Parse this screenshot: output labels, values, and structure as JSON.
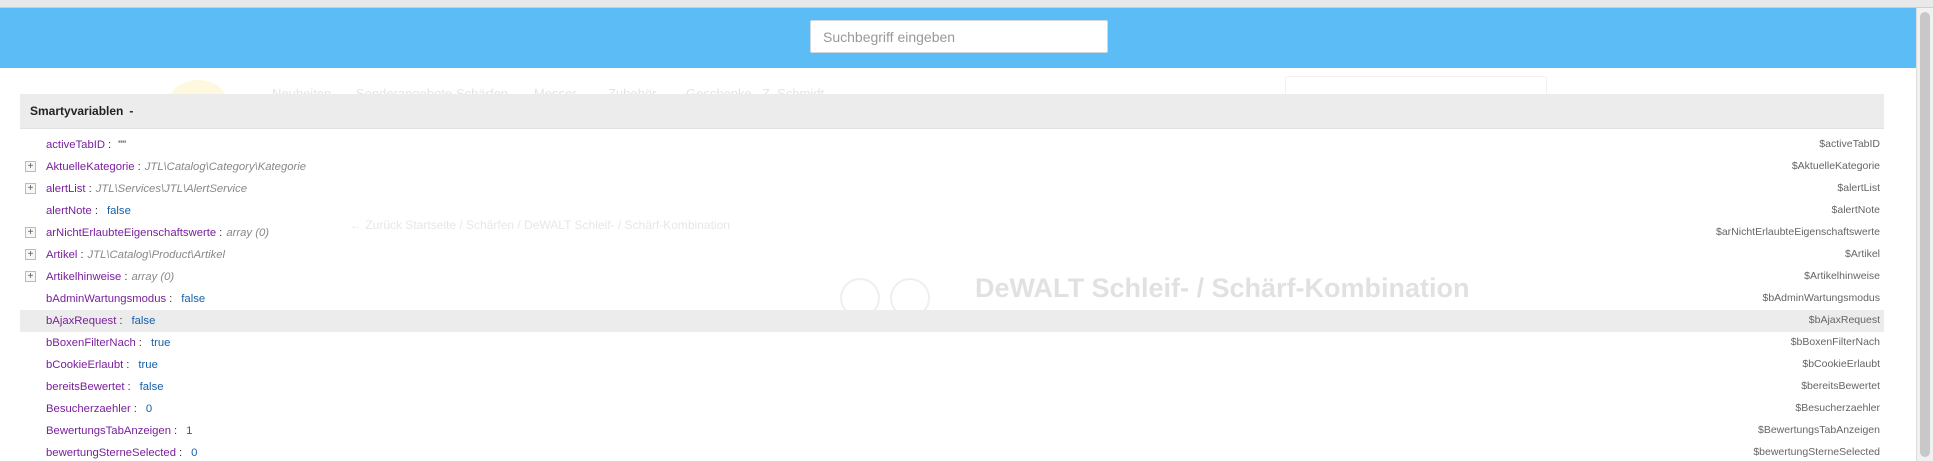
{
  "search": {
    "placeholder": "Suchbegriff eingeben"
  },
  "background": {
    "nav": [
      "Neuheiten",
      "Sonderangebote",
      "Schärfen",
      "Messer",
      "Zubehör",
      "Geschenke",
      "Z. Schmidt"
    ],
    "breadcrumb": "← Zurück   Startseite  /  Schärfen  /  DeWALT Schleif- / Schärf-Kombination",
    "title": "DeWALT Schleif- / Schärf-Kombination"
  },
  "panel": {
    "title": "Smartyvariablen",
    "toggle": "-",
    "rows": [
      {
        "name": "activeTabID",
        "value": "\"\"",
        "kind": "str",
        "expandable": false,
        "path": "$activeTabID"
      },
      {
        "name": "AktuelleKategorie",
        "value": "JTL\\Catalog\\Category\\Kategorie",
        "kind": "class",
        "expandable": true,
        "path": "$AktuelleKategorie"
      },
      {
        "name": "alertList",
        "value": "JTL\\Services\\JTL\\AlertService",
        "kind": "class",
        "expandable": true,
        "path": "$alertList"
      },
      {
        "name": "alertNote",
        "value": "false",
        "kind": "bool",
        "expandable": false,
        "path": "$alertNote"
      },
      {
        "name": "arNichtErlaubteEigenschaftswerte",
        "value": "array (0)",
        "kind": "class",
        "expandable": true,
        "path": "$arNichtErlaubteEigenschaftswerte"
      },
      {
        "name": "Artikel",
        "value": "JTL\\Catalog\\Product\\Artikel",
        "kind": "class",
        "expandable": true,
        "path": "$Artikel"
      },
      {
        "name": "Artikelhinweise",
        "value": "array (0)",
        "kind": "class",
        "expandable": true,
        "path": "$Artikelhinweise"
      },
      {
        "name": "bAdminWartungsmodus",
        "value": "false",
        "kind": "bool",
        "expandable": false,
        "path": "$bAdminWartungsmodus"
      },
      {
        "name": "bAjaxRequest",
        "value": "false",
        "kind": "bool",
        "expandable": false,
        "path": "$bAjaxRequest",
        "highlight": true
      },
      {
        "name": "bBoxenFilterNach",
        "value": "true",
        "kind": "bool",
        "expandable": false,
        "path": "$bBoxenFilterNach"
      },
      {
        "name": "bCookieErlaubt",
        "value": "true",
        "kind": "bool",
        "expandable": false,
        "path": "$bCookieErlaubt"
      },
      {
        "name": "bereitsBewertet",
        "value": "false",
        "kind": "bool",
        "expandable": false,
        "path": "$bereitsBewertet"
      },
      {
        "name": "Besucherzaehler",
        "value": "0",
        "kind": "num",
        "expandable": false,
        "path": "$Besucherzaehler"
      },
      {
        "name": "BewertungsTabAnzeigen",
        "value": "1",
        "kind": "num",
        "expandable": false,
        "path": "$BewertungsTabAnzeigen"
      },
      {
        "name": "bewertungSterneSelected",
        "value": "0",
        "kind": "num",
        "expandable": false,
        "path": "$bewertungSterneSelected"
      }
    ]
  },
  "colors": {
    "header": "#5bbcf6",
    "varname": "#7a1f9c",
    "value": "#1560a8"
  }
}
